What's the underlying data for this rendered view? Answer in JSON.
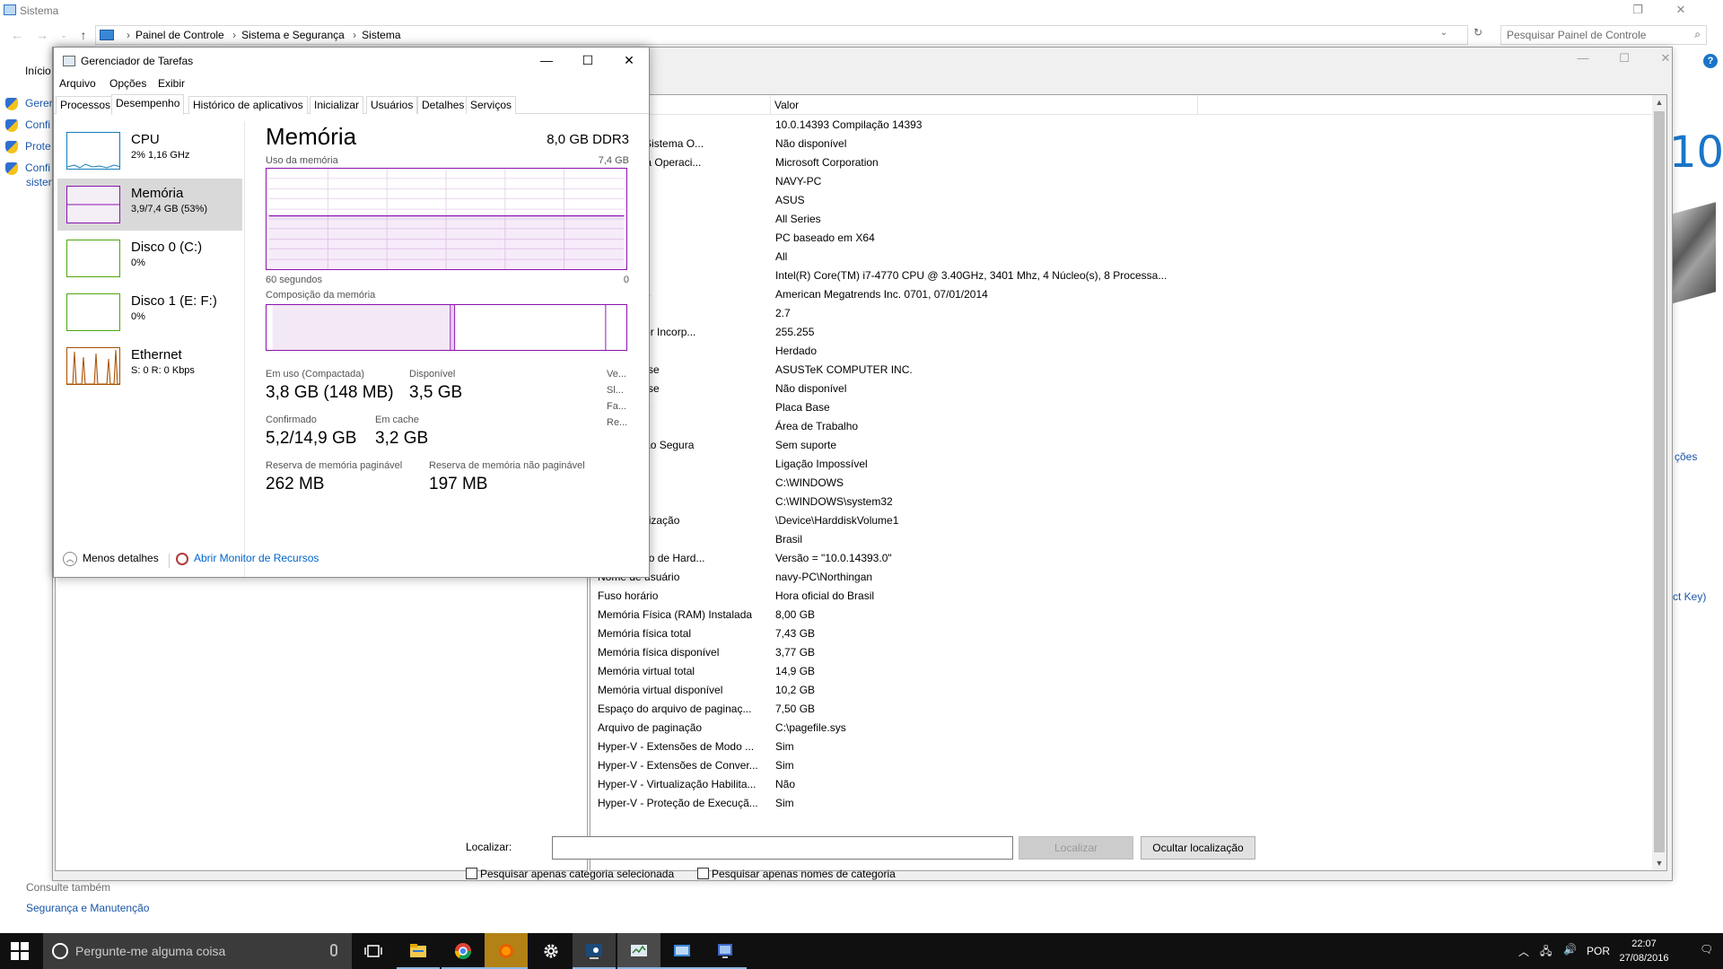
{
  "control_panel": {
    "title": "Sistema",
    "breadcrumbs": [
      "Painel de Controle",
      "Sistema e Segurança",
      "Sistema"
    ],
    "search_placeholder": "Pesquisar Painel de Controle",
    "left_home": "Início",
    "left_items": [
      "Gerer",
      "Confi",
      "Prote",
      "Confi"
    ],
    "left_item_extra": "sisten",
    "see_also": "Consulte também",
    "security_link": "Segurança e Manutenção",
    "right_fragments": [
      "10",
      "ções",
      "ct Key)"
    ]
  },
  "sysinfo": {
    "column_value": "Valor",
    "rows": [
      {
        "k": "",
        "v": "10.0.14393 Compilação 14393"
      },
      {
        "k": "crição do Sistema O...",
        "v": "Não disponível"
      },
      {
        "k": "do Sistema Operaci...",
        "v": "Microsoft Corporation"
      },
      {
        "k": "sistema",
        "v": "NAVY-PC"
      },
      {
        "k": "do sistema",
        "v": "ASUS"
      },
      {
        "k": "o sistema",
        "v": "All Series"
      },
      {
        "k": "stema",
        "v": "PC baseado em X64"
      },
      {
        "k": "stema",
        "v": "All"
      },
      {
        "k": "or",
        "v": "Intel(R) Core(TM) i7-4770 CPU @ 3.40GHz, 3401 Mhz, 4 Núcleo(s), 8 Processa..."
      },
      {
        "k": "ta do BIOS",
        "v": "American Megatrends Inc. 0701, 07/01/2014"
      },
      {
        "k": "SMBIOS",
        "v": "2.7"
      },
      {
        "k": "Controlador Incorp...",
        "v": "255.255"
      },
      {
        "k": "BIOS",
        "v": "Herdado"
      },
      {
        "k": "a placa-base",
        "v": "ASUSTeK COMPUTER INC."
      },
      {
        "k": "a placa-base",
        "v": "Não disponível"
      },
      {
        "k": "placa-base",
        "v": "Placa Base"
      },
      {
        "k": "Plataforma",
        "v": "Área de Trabalho"
      },
      {
        "k": "Inicialização Segura",
        "v": "Sem suporte"
      },
      {
        "k": "ão PCR7",
        "v": "Ligação Impossível"
      },
      {
        "k": "Windows",
        "v": "C:\\WINDOWS"
      },
      {
        "k": "sistema",
        "v": "C:\\WINDOWS\\system32"
      },
      {
        "k": "o de inicialização",
        "v": "\\Device\\HarddiskVolume1"
      },
      {
        "k": "e",
        "v": "Brasil"
      },
      {
        "k": "e Abstração de Hard...",
        "v": "Versão = \"10.0.14393.0\""
      },
      {
        "k": "Nome de usuário",
        "v": "navy-PC\\Northingan"
      },
      {
        "k": "Fuso horário",
        "v": "Hora oficial do Brasil"
      },
      {
        "k": "Memória Física (RAM) Instalada",
        "v": "8,00 GB"
      },
      {
        "k": "Memória física total",
        "v": "7,43 GB"
      },
      {
        "k": "Memória física disponível",
        "v": "3,77 GB"
      },
      {
        "k": "Memória virtual total",
        "v": "14,9 GB"
      },
      {
        "k": "Memória virtual disponível",
        "v": "10,2 GB"
      },
      {
        "k": "Espaço do arquivo de paginaç...",
        "v": "7,50 GB"
      },
      {
        "k": "Arquivo de paginação",
        "v": "C:\\pagefile.sys"
      },
      {
        "k": "Hyper-V - Extensões de Modo ...",
        "v": "Sim"
      },
      {
        "k": "Hyper-V - Extensões de Conver...",
        "v": "Sim"
      },
      {
        "k": "Hyper-V - Virtualização Habilita...",
        "v": "Não"
      },
      {
        "k": "Hyper-V - Proteção de Execuçã...",
        "v": "Sim"
      }
    ],
    "find_label": "Localizar:",
    "find_value": "",
    "find_button": "Localizar",
    "hide_find_button": "Ocultar localização",
    "check_category": "Pesquisar apenas categoria selecionada",
    "check_names": "Pesquisar apenas nomes de categoria"
  },
  "taskmgr": {
    "title": "Gerenciador de Tarefas",
    "menu": [
      "Arquivo",
      "Opções",
      "Exibir"
    ],
    "tabs": [
      "Processos",
      "Desempenho",
      "Histórico de aplicativos",
      "Inicializar",
      "Usuários",
      "Detalhes",
      "Serviços"
    ],
    "active_tab": 1,
    "side": [
      {
        "name": "CPU",
        "sub": "2% 1,16 GHz",
        "color": "#117dbb"
      },
      {
        "name": "Memória",
        "sub": "3,9/7,4 GB (53%)",
        "color": "#8b12ae"
      },
      {
        "name": "Disco 0 (C:)",
        "sub": "0%",
        "color": "#4da60c"
      },
      {
        "name": "Disco 1 (E: F:)",
        "sub": "0%",
        "color": "#4da60c"
      },
      {
        "name": "Ethernet",
        "sub": "S: 0 R: 0 Kbps",
        "color": "#a74f01"
      }
    ],
    "heading": "Memória",
    "spec": "8,0 GB DDR3",
    "usage_label": "Uso da memória",
    "usage_max": "7,4 GB",
    "axis_left": "60 segundos",
    "axis_right": "0",
    "composition_label": "Composição da memória",
    "usage_fraction": 0.53,
    "stats": {
      "in_use_label": "Em uso (Compactada)",
      "in_use": "3,8 GB (148 MB)",
      "available_label": "Disponível",
      "available": "3,5 GB",
      "committed_label": "Confirmado",
      "committed": "5,2/14,9 GB",
      "cached_label": "Em cache",
      "cached": "3,2 GB",
      "paged_label": "Reserva de memória paginável",
      "paged": "262 MB",
      "nonpaged_label": "Reserva de memória não paginável",
      "nonpaged": "197 MB",
      "right_col": [
        "Ve...",
        "Sl...",
        "Fa...",
        "Re..."
      ]
    },
    "fewer_details": "Menos detalhes",
    "resource_monitor": "Abrir Monitor de Recursos"
  },
  "taskbar": {
    "search_text": "Pergunte-me alguma coisa",
    "language": "POR",
    "time": "22:07",
    "date": "27/08/2016"
  }
}
